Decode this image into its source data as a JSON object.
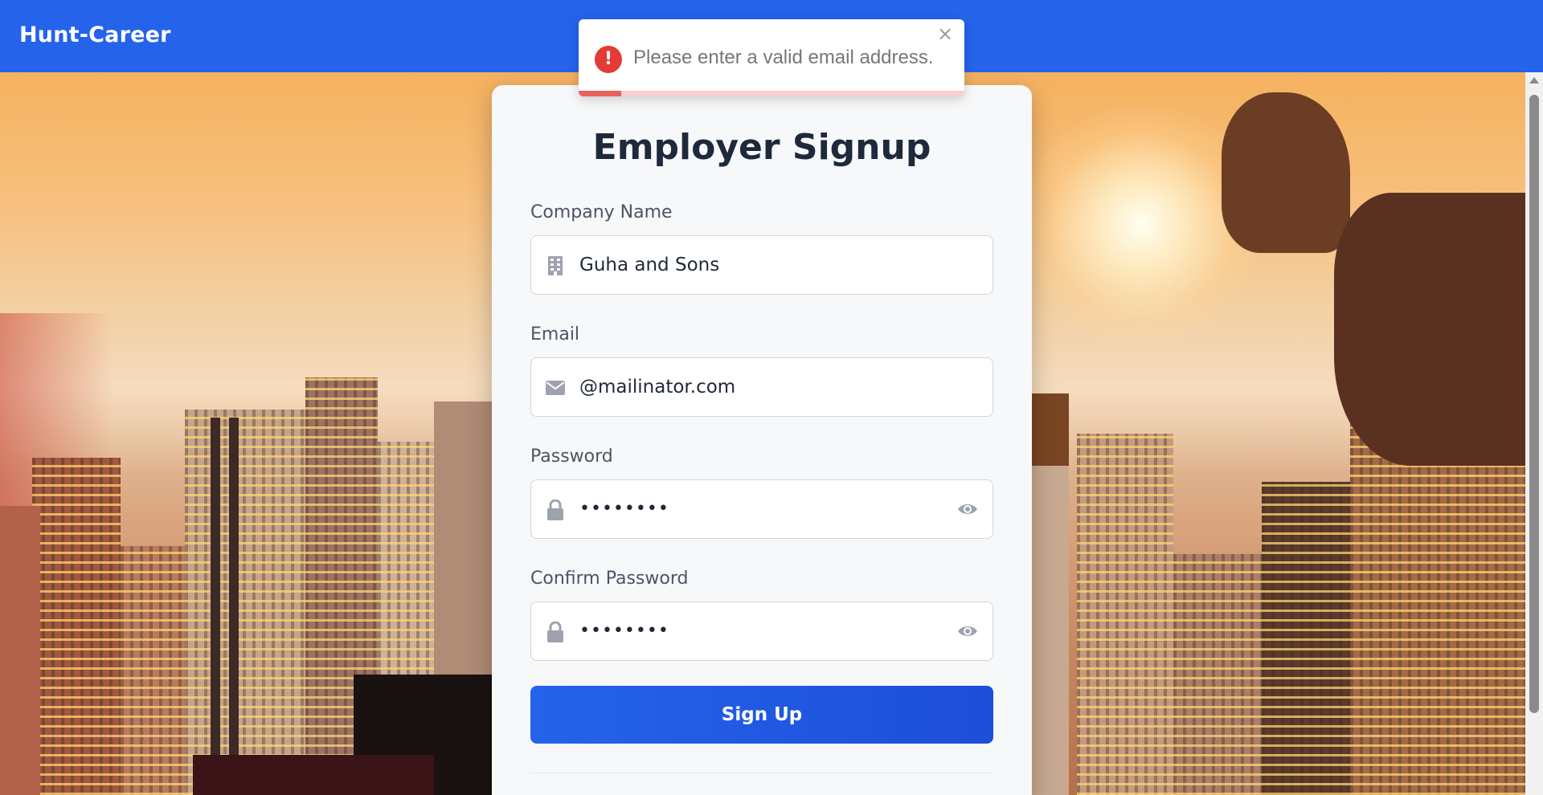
{
  "header": {
    "brand": "Hunt-Career"
  },
  "toast": {
    "message": "Please enter a valid email address.",
    "icon": "error-icon",
    "close_glyph": "×",
    "progress_remaining": 0.11,
    "color": "#e23c34"
  },
  "form": {
    "title": "Employer Signup",
    "company": {
      "label": "Company Name",
      "value": "Guha and Sons",
      "icon": "building-icon"
    },
    "email": {
      "label": "Email",
      "value": "@mailinator.com",
      "icon": "envelope-icon"
    },
    "password": {
      "label": "Password",
      "value": "••••••••",
      "icon": "lock-icon",
      "toggle_icon": "eye-icon"
    },
    "confirm_password": {
      "label": "Confirm Password",
      "value": "••••••••",
      "icon": "lock-icon",
      "toggle_icon": "eye-icon"
    },
    "submit_label": "Sign Up"
  },
  "colors": {
    "primary": "#2563eb",
    "title": "#1e293b",
    "error": "#e23c34"
  }
}
